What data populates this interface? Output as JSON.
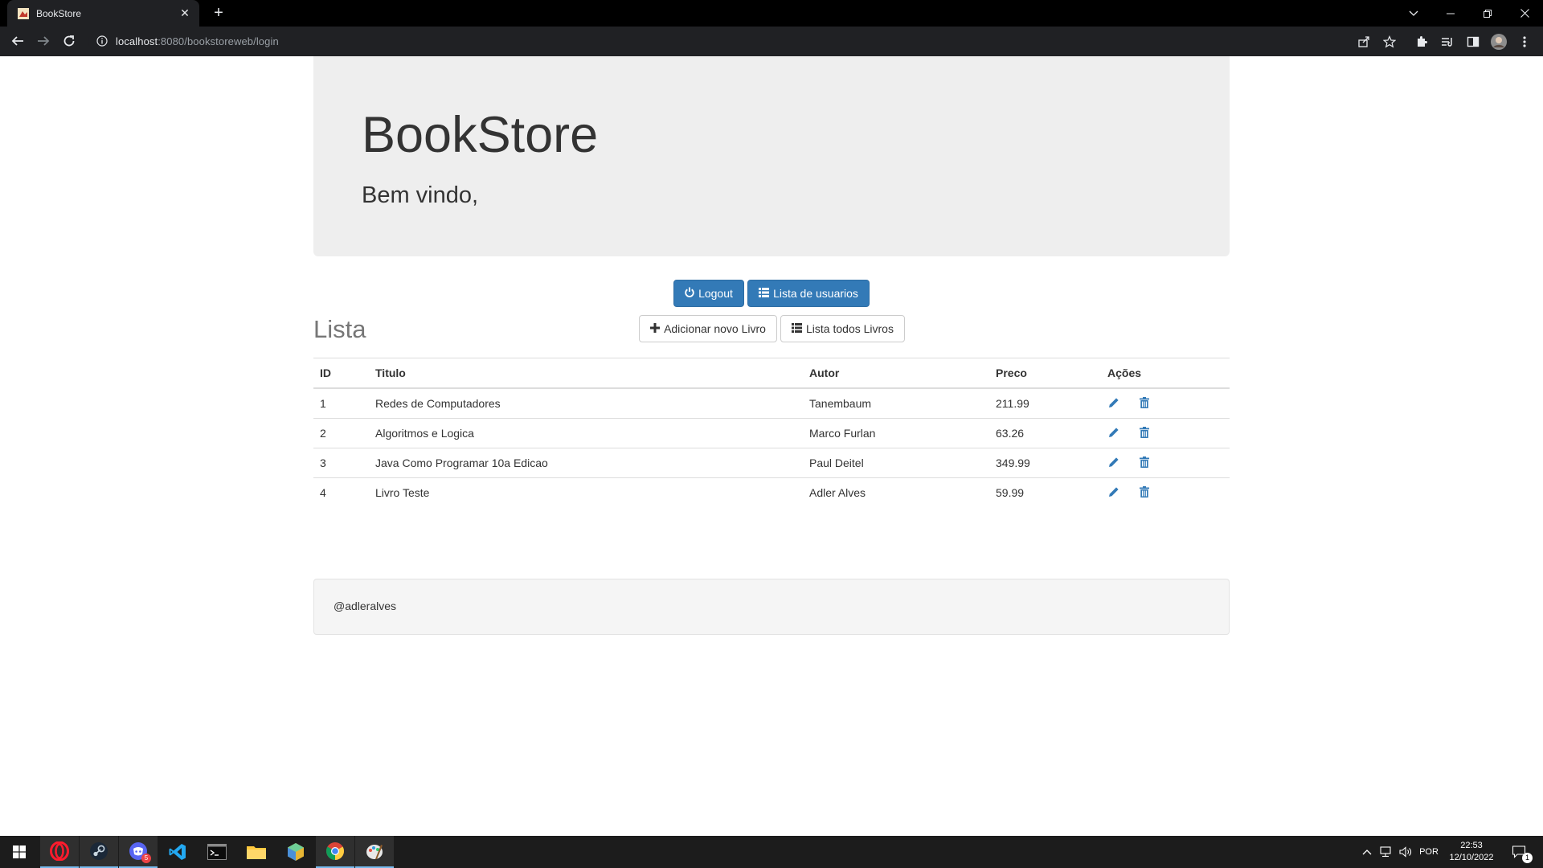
{
  "browser": {
    "tab_title": "BookStore",
    "url_host": "localhost",
    "url_rest": ":8080/bookstoreweb/login"
  },
  "header": {
    "title": "BookStore",
    "subtitle": "Bem vindo,"
  },
  "actions": {
    "logout": "Logout",
    "user_list": "Lista de usuarios",
    "add_book": "Adicionar novo Livro",
    "list_books": "Lista todos Livros"
  },
  "list": {
    "title": "Lista",
    "columns": [
      "ID",
      "Titulo",
      "Autor",
      "Preco",
      "Ações"
    ],
    "rows": [
      {
        "id": "1",
        "titulo": "Redes de Computadores",
        "autor": "Tanembaum",
        "preco": "211.99"
      },
      {
        "id": "2",
        "titulo": "Algoritmos e Logica",
        "autor": "Marco Furlan",
        "preco": "63.26"
      },
      {
        "id": "3",
        "titulo": "Java Como Programar 10a Edicao",
        "autor": "Paul Deitel",
        "preco": "349.99"
      },
      {
        "id": "4",
        "titulo": "Livro Teste",
        "autor": "Adler Alves",
        "preco": "59.99"
      }
    ]
  },
  "footer": {
    "text": "@adleralves"
  },
  "taskbar": {
    "language": "POR",
    "time": "22:53",
    "date": "12/10/2022",
    "notification_count": "1",
    "discord_badge": "5"
  },
  "colors": {
    "primary": "#337ab7",
    "jumbotron": "#eeeeee",
    "icon_blue": "#337ab7"
  }
}
